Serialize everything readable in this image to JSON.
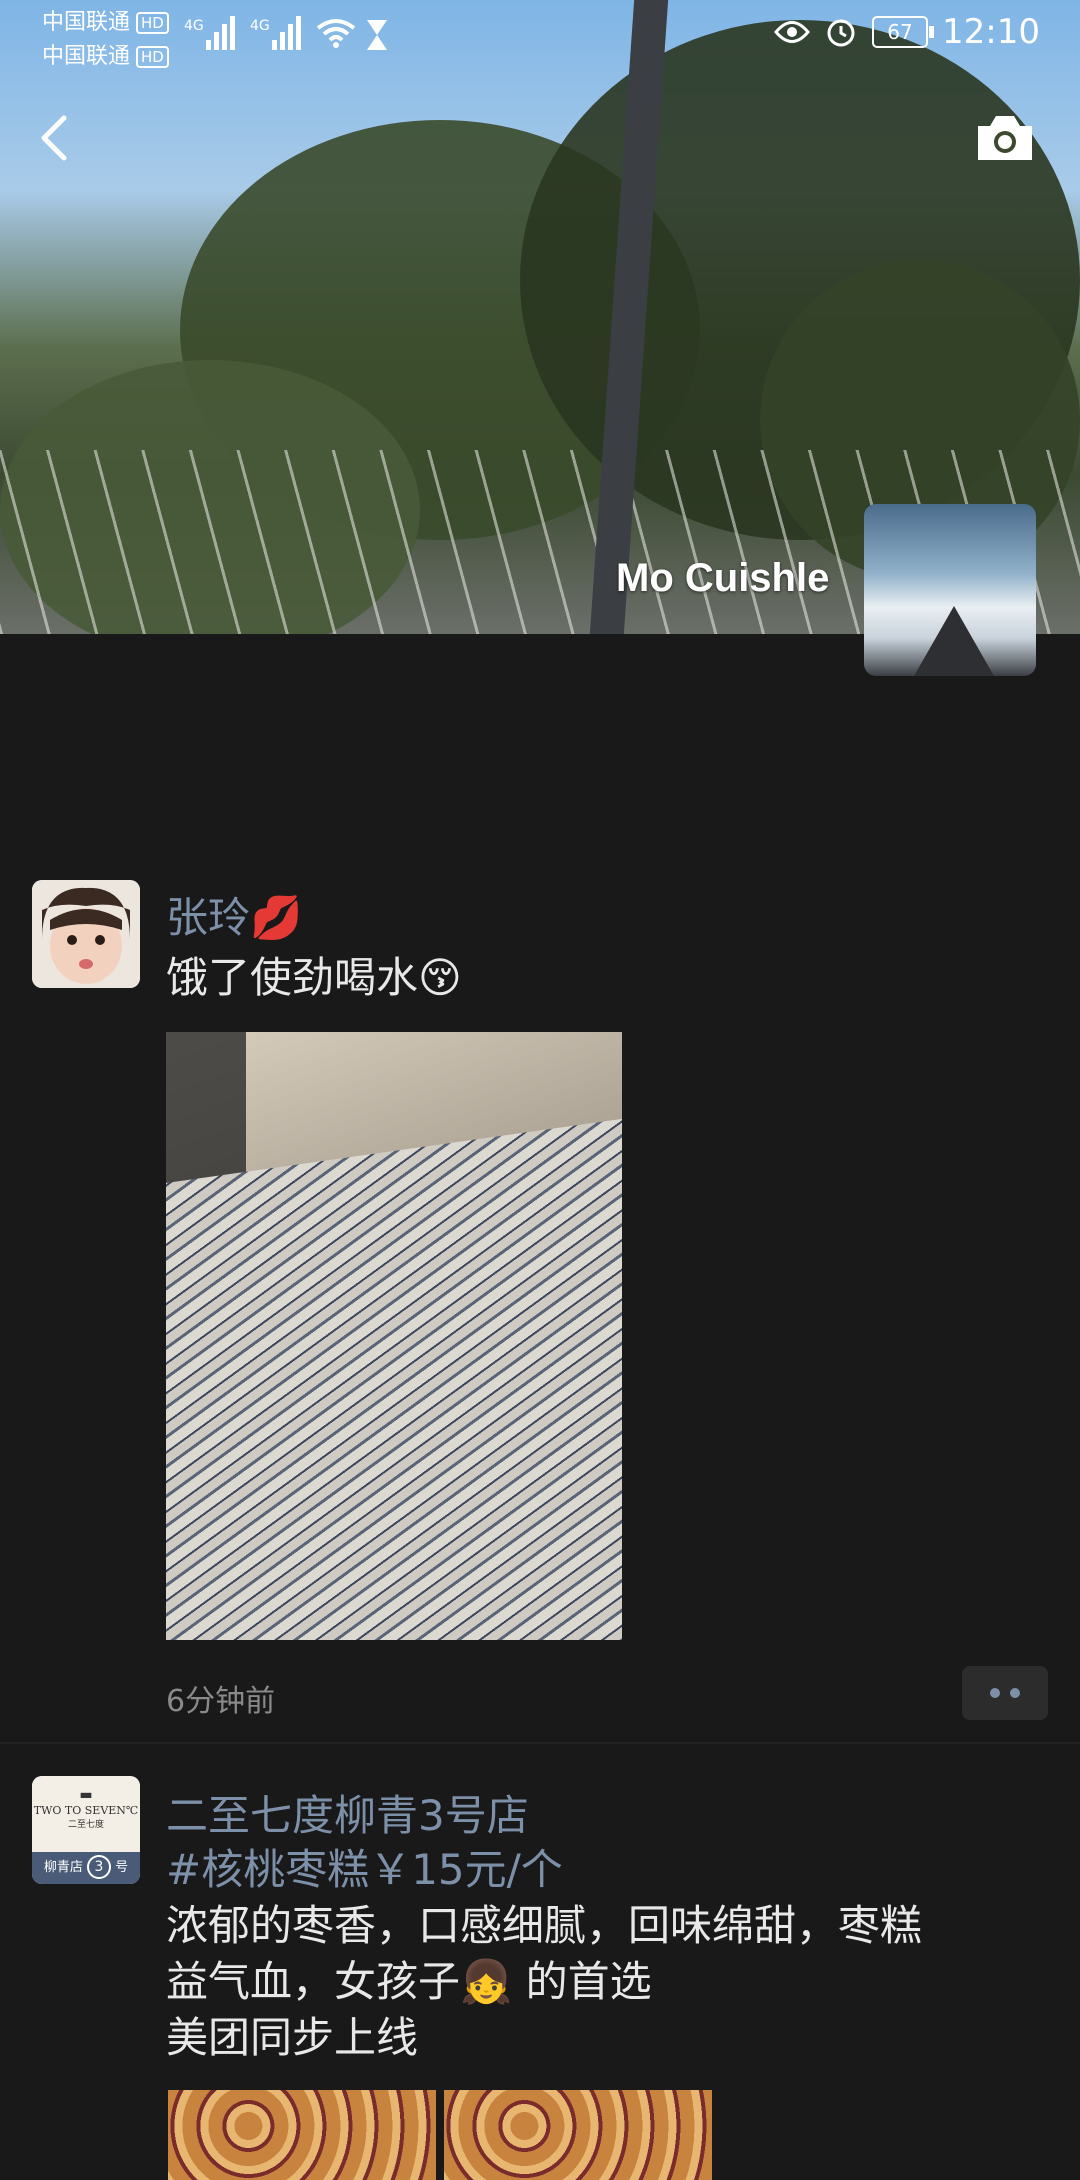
{
  "status_bar": {
    "carrier1": "中国联通",
    "carrier2": "中国联通",
    "hd": "HD",
    "network1": "4G",
    "network2": "4G",
    "battery": "67",
    "time": "12:10"
  },
  "profile": {
    "username": "Mo Cuishle"
  },
  "posts": [
    {
      "name": "张玲💋",
      "text": "饿了使劲喝水😚",
      "time": "6分钟前"
    },
    {
      "name": "二至七度柳青3号店",
      "avatar_line1": "TWO TO SEVEN℃",
      "avatar_line2": "二至七度",
      "avatar_line3": "柳青店",
      "avatar_number": "3",
      "avatar_suffix": "号",
      "tag": "#核桃枣糕￥15元/个",
      "line1": "浓郁的枣香，口感细腻，回味绵甜，枣糕",
      "line2": "益气血，女孩子👧 的首选",
      "line3": "美团同步上线"
    }
  ],
  "colors": {
    "background": "#191919",
    "link_name": "#7d90a9",
    "text": "#e8e8e8",
    "time": "#8a8a8a"
  }
}
